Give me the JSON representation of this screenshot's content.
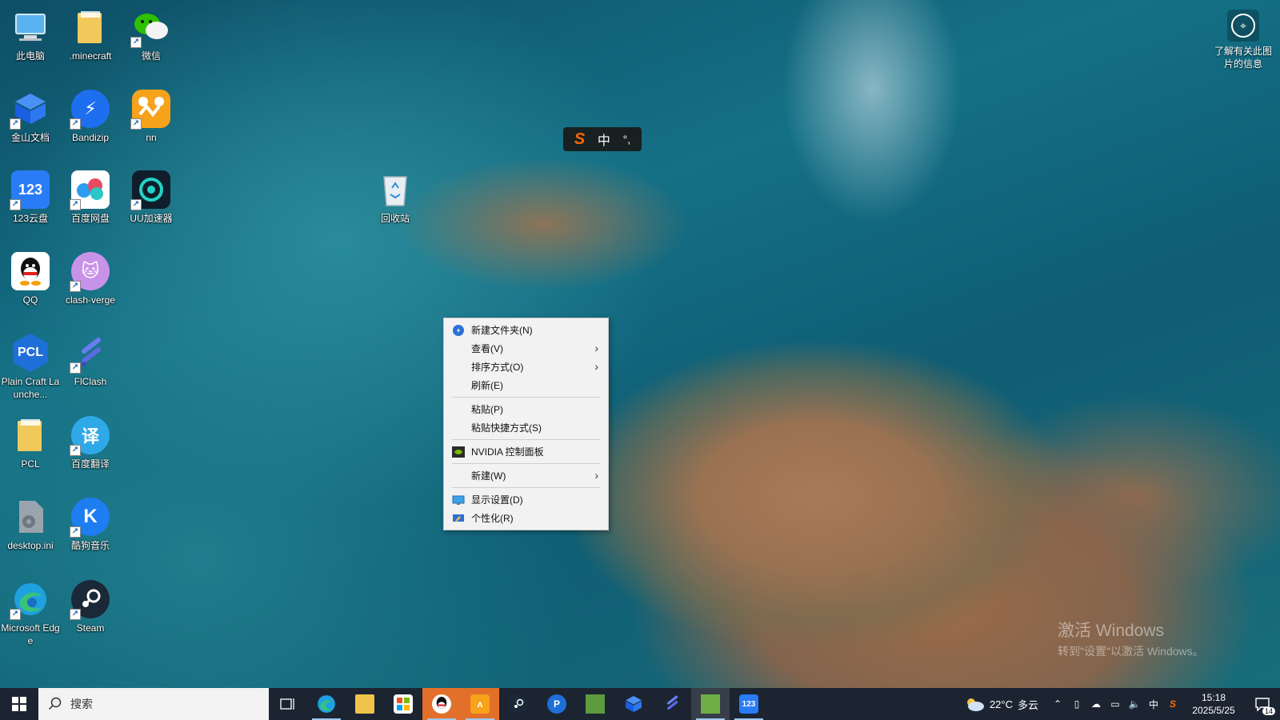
{
  "desktop": {
    "icons": [
      {
        "label": "此电脑",
        "icon": "computer-icon"
      },
      {
        "label": ".minecraft",
        "icon": "folder-icon"
      },
      {
        "label": "微信",
        "icon": "wechat-icon"
      },
      {
        "label": "金山文档",
        "icon": "kdocs-icon"
      },
      {
        "label": "Bandizip",
        "icon": "bandizip-icon"
      },
      {
        "label": "nn",
        "icon": "nn-accelerator-icon"
      },
      {
        "label": "123云盘",
        "icon": "123pan-icon"
      },
      {
        "label": "百度网盘",
        "icon": "baidu-netdisk-icon"
      },
      {
        "label": "UU加速器",
        "icon": "uu-accelerator-icon"
      },
      {
        "label": "回收站",
        "icon": "recycle-bin-icon"
      },
      {
        "label": "QQ",
        "icon": "qq-icon"
      },
      {
        "label": "clash-verge",
        "icon": "clash-verge-icon"
      },
      {
        "label": "Plain Craft Launche...",
        "icon": "pcl-icon"
      },
      {
        "label": "FlClash",
        "icon": "flclash-icon"
      },
      {
        "label": "PCL",
        "icon": "folder-icon"
      },
      {
        "label": "百度翻译",
        "icon": "baidu-translate-icon"
      },
      {
        "label": "desktop.ini",
        "icon": "settings-file-icon"
      },
      {
        "label": "酷狗音乐",
        "icon": "kugou-icon"
      },
      {
        "label": "Microsoft Edge",
        "icon": "edge-icon"
      },
      {
        "label": "Steam",
        "icon": "steam-icon"
      }
    ],
    "info_button": {
      "label": "了解有关此图片的信息"
    }
  },
  "ime": {
    "logo": "S",
    "mode": "中",
    "punct": "°,"
  },
  "context_menu": {
    "items": [
      {
        "label": "新建文件夹(N)",
        "icon": "new-folder-icon"
      },
      {
        "label": "查看(V)",
        "submenu": true
      },
      {
        "label": "排序方式(O)",
        "submenu": true
      },
      {
        "label": "刷新(E)"
      },
      {
        "label": "粘贴(P)"
      },
      {
        "label": "粘贴快捷方式(S)"
      },
      {
        "label": "NVIDIA 控制面板",
        "icon": "nvidia-icon"
      },
      {
        "label": "新建(W)",
        "submenu": true
      },
      {
        "label": "显示设置(D)",
        "icon": "display-icon"
      },
      {
        "label": "个性化(R)",
        "icon": "personalize-icon"
      }
    ]
  },
  "watermark": {
    "line1": "激活 Windows",
    "line2": "转到\"设置\"以激活 Windows。"
  },
  "taskbar": {
    "search_placeholder": "搜索",
    "weather": {
      "temp": "22°C",
      "desc": "多云"
    },
    "tray_ime": "中",
    "clock_time": "15:18",
    "clock_date": "2025/5/25",
    "notification_count": "14"
  },
  "colors": {
    "taskbar": "#1c2432",
    "menu_bg": "#f2f2f2",
    "ime_accent": "#ff6a00"
  }
}
